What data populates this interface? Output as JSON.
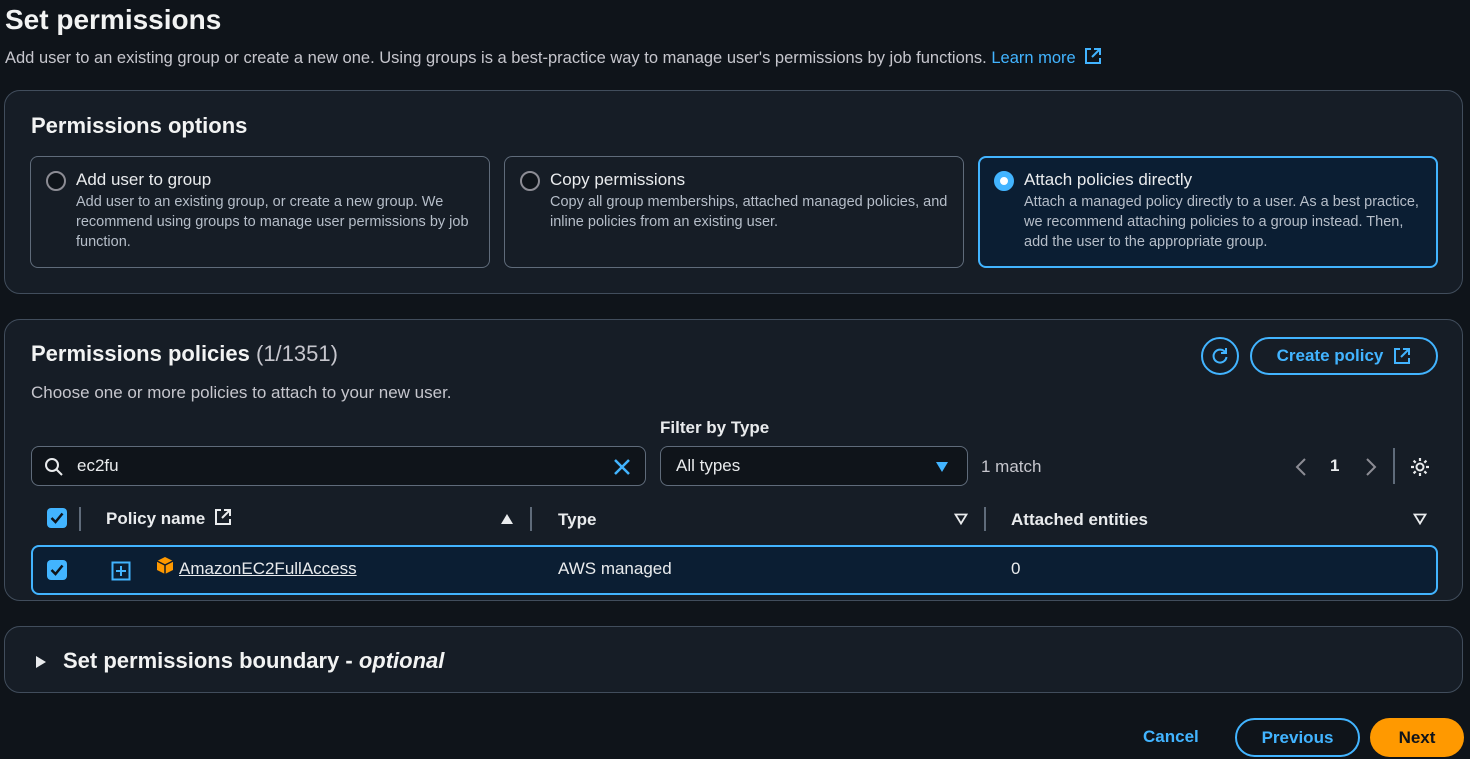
{
  "header": {
    "title": "Set permissions",
    "description": "Add user to an existing group or create a new one. Using groups is a best-practice way to manage user's permissions by job functions.",
    "learn_more": "Learn more"
  },
  "permissions_options": {
    "title": "Permissions options",
    "options": [
      {
        "label": "Add user to group",
        "description": "Add user to an existing group, or create a new group. We recommend using groups to manage user permissions by job function.",
        "selected": false
      },
      {
        "label": "Copy permissions",
        "description": "Copy all group memberships, attached managed policies, and inline policies from an existing user.",
        "selected": false
      },
      {
        "label": "Attach policies directly",
        "description": "Attach a managed policy directly to a user. As a best practice, we recommend attaching policies to a group instead. Then, add the user to the appropriate group.",
        "selected": true
      }
    ]
  },
  "policies": {
    "title": "Permissions policies",
    "count": "(1/1351)",
    "description": "Choose one or more policies to attach to your new user.",
    "create_policy_label": "Create policy",
    "search": {
      "value": "ec2fu",
      "placeholder": ""
    },
    "filter": {
      "label": "Filter by Type",
      "selected": "All types"
    },
    "match_text": "1 match",
    "pagination": {
      "current_page": "1"
    },
    "columns": [
      "Policy name",
      "Type",
      "Attached entities"
    ],
    "rows": [
      {
        "name": "AmazonEC2FullAccess",
        "type": "AWS managed",
        "attached": "0",
        "selected": true
      }
    ]
  },
  "boundary": {
    "title": "Set permissions boundary - ",
    "optional": "optional"
  },
  "footer": {
    "cancel": "Cancel",
    "previous": "Previous",
    "next": "Next"
  },
  "colors": {
    "accent": "#42b4ff",
    "primary": "#ff9900",
    "background": "#0f141a",
    "panel": "#161d26"
  }
}
